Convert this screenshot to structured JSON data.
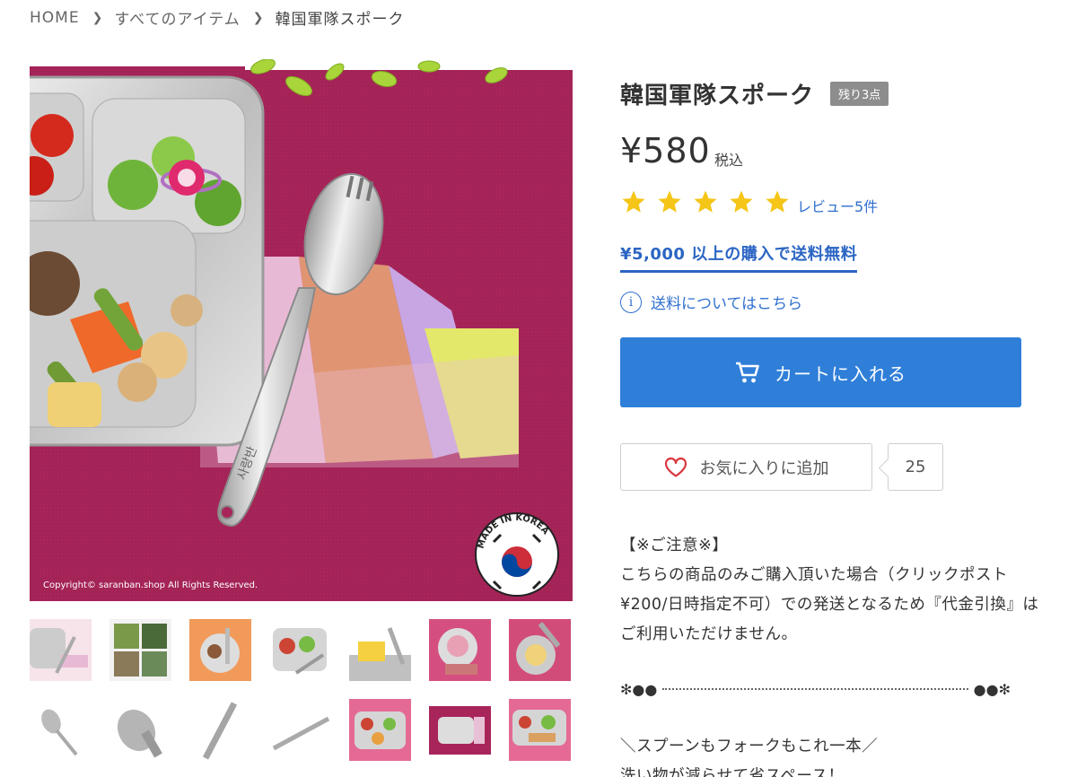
{
  "breadcrumb": {
    "home": "HOME",
    "all_items": "すべてのアイテム",
    "current": "韓国軍隊スポーク"
  },
  "image": {
    "copyright": "Copyright© saranban.shop All Rights Reserved.",
    "badge_text": "MADE IN KOREA",
    "spoon_engraving": "사랑반"
  },
  "product": {
    "title": "韓国軍隊スポーク",
    "stock_badge": "残り3点",
    "price": "¥580",
    "tax_label": "税込",
    "rating": 5,
    "rating_max": 5,
    "review_link": "レビュー5件",
    "free_shipping": "¥5,000 以上の購入で送料無料",
    "shipping_info": "送料についてはこちら",
    "cart_button": "カートに入れる",
    "favorite_button": "お気に入りに追加",
    "favorite_count": "25"
  },
  "description": {
    "notice_title": "【※ご注意※】",
    "line1": "こちらの商品のみご購入頂いた場合（クリックポスト",
    "line2": "¥200/日時指定不可）での発送となるため『代金引換』は",
    "line3": "ご利用いただけません。",
    "divider_left": "✻●●",
    "divider_right": "●●✻",
    "catch1": "＼スプーンもフォークもこれ一本／",
    "catch2": "洗い物が減らせて省スペース！"
  },
  "colors": {
    "accent": "#2f7fd9",
    "link": "#2f6fcf",
    "star": "#f5c518",
    "badge": "#8d8d8d",
    "cloth": "#a8255a"
  },
  "thumbnails": [
    "thumb-1",
    "thumb-2",
    "thumb-3",
    "thumb-4",
    "thumb-5",
    "thumb-6",
    "thumb-7",
    "thumb-8",
    "thumb-9",
    "thumb-10",
    "thumb-11",
    "thumb-12",
    "thumb-13",
    "thumb-14"
  ]
}
